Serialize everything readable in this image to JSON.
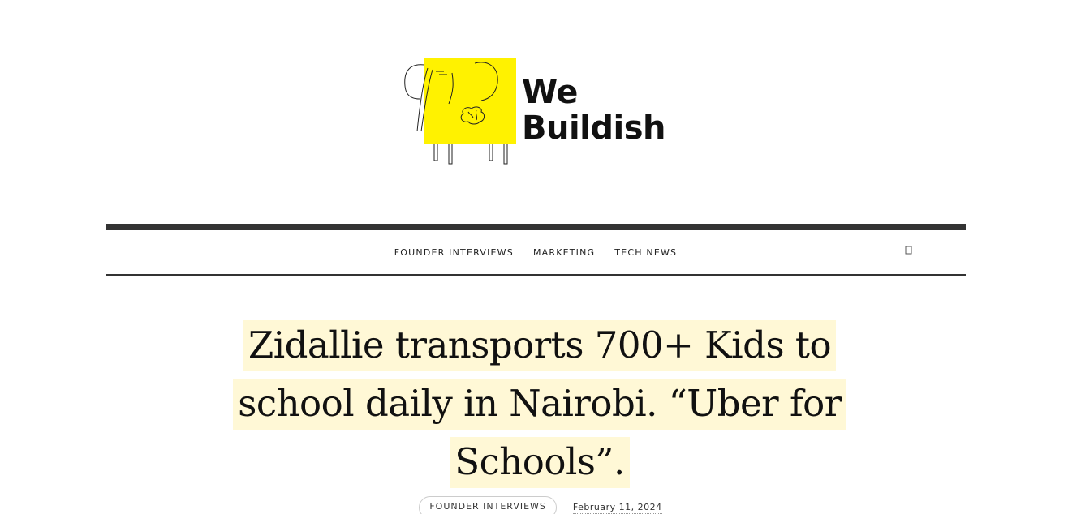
{
  "site": {
    "logo_line1": "We",
    "logo_line2": "Buildish",
    "brand_color": "#fff200"
  },
  "nav": {
    "items": [
      {
        "label": "FOUNDER INTERVIEWS"
      },
      {
        "label": "MARKETING"
      },
      {
        "label": "TECH NEWS"
      }
    ],
    "search_icon": "search-icon"
  },
  "article": {
    "title": "Zidallie transports 700+ Kids to school daily in Nairobi. “Uber for Schools”.",
    "category": "FOUNDER INTERVIEWS",
    "date": "February 11, 2024",
    "highlight_color": "#fff8d6"
  }
}
